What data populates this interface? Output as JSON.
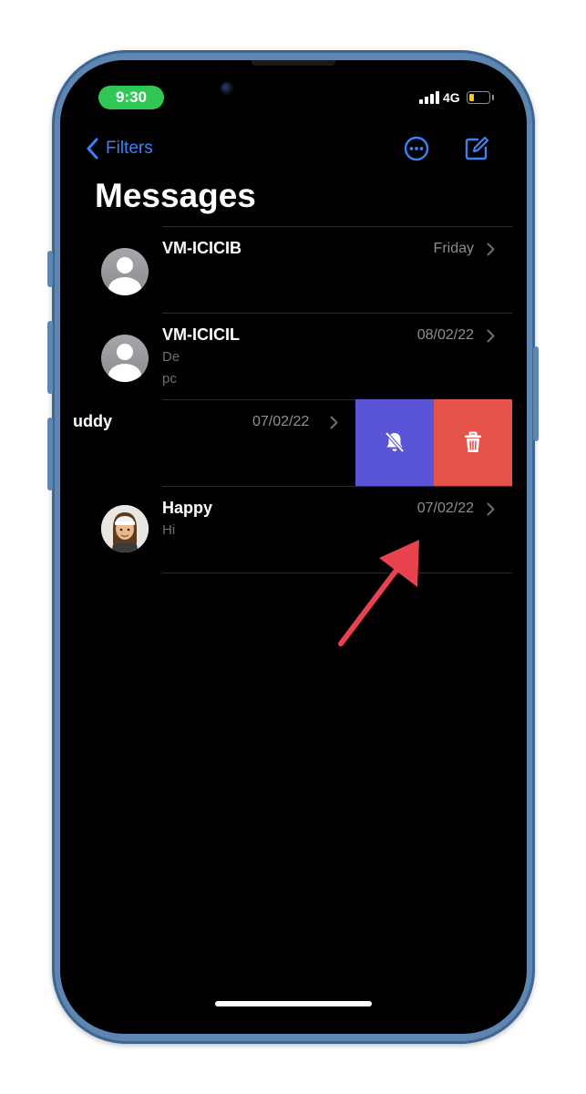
{
  "status_bar": {
    "time": "9:30",
    "network": "4G",
    "battery_level": 0.2,
    "battery_color": "#ffcc00",
    "time_pill_color": "#30c754"
  },
  "nav": {
    "back_label": "Filters",
    "back_icon": "chevron-left-icon",
    "more_icon": "ellipsis-circle-icon",
    "compose_icon": "compose-icon",
    "accent_color": "#3b82f6"
  },
  "title": "Messages",
  "conversations": [
    {
      "name": "VM-ICICIB",
      "date": "Friday",
      "preview_line1": "",
      "preview_line2": ""
    },
    {
      "name": "VM-ICICIL",
      "date": "08/02/22",
      "preview_line1": "De",
      "preview_line2": "pc"
    },
    {
      "name": "uddy",
      "date": "07/02/22",
      "preview_line1": "",
      "preview_line2": ""
    },
    {
      "name": "Happy",
      "date": "07/02/22",
      "preview_line1": "Hi",
      "preview_line2": ""
    }
  ],
  "swipe_actions": {
    "mute_icon": "bell-slash-icon",
    "mute_color": "#5a55d6",
    "delete_icon": "trash-icon",
    "delete_color": "#e5534b"
  },
  "annotation": {
    "arrow_color": "#e8424f"
  }
}
